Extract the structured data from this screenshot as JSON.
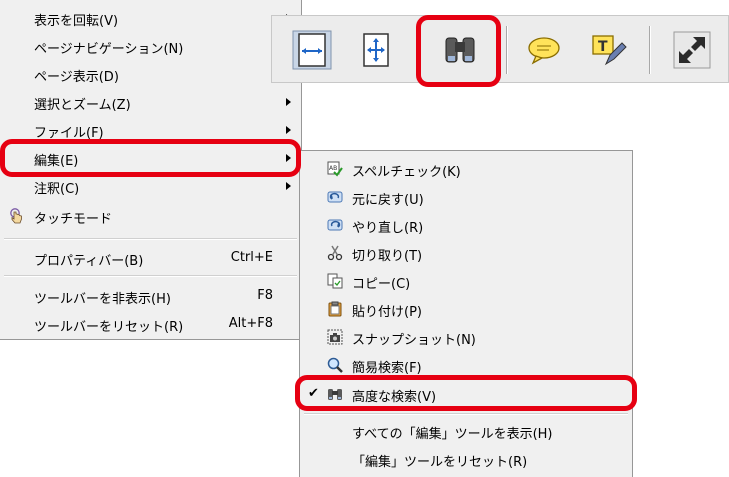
{
  "main_menu": {
    "items": [
      {
        "label": "表示を回転(V)",
        "arrow": true
      },
      {
        "label": "ページナビゲーション(N)"
      },
      {
        "label": "ページ表示(D)"
      },
      {
        "label": "選択とズーム(Z)",
        "arrow": true
      },
      {
        "label": "ファイル(F)",
        "arrow": true
      },
      {
        "label": "編集(E)",
        "arrow": true
      },
      {
        "label": "注釈(C)",
        "arrow": true
      },
      {
        "label": "タッチモード",
        "icon": "touch-hand-icon"
      },
      {
        "label": "プロパティバー(B)",
        "shortcut": "Ctrl+E"
      },
      {
        "label": "ツールバーを非表示(H)",
        "shortcut": "F8"
      },
      {
        "label": "ツールバーをリセット(R)",
        "shortcut": "Alt+F8"
      }
    ]
  },
  "edit_menu": {
    "items": [
      {
        "label": "スペルチェック(K)",
        "icon": "spellcheck-icon"
      },
      {
        "label": "元に戻す(U)",
        "icon": "undo-icon"
      },
      {
        "label": "やり直し(R)",
        "icon": "redo-icon"
      },
      {
        "label": "切り取り(T)",
        "icon": "scissors-icon"
      },
      {
        "label": "コピー(C)",
        "icon": "copy-icon"
      },
      {
        "label": "貼り付け(P)",
        "icon": "paste-icon"
      },
      {
        "label": "スナップショット(N)",
        "icon": "camera-icon"
      },
      {
        "label": "簡易検索(F)",
        "icon": "magnifier-icon"
      },
      {
        "label": "高度な検索(V)",
        "icon": "binoculars-icon",
        "checked": true,
        "check_mark": "✔"
      },
      {
        "label": "すべての「編集」ツールを表示(H)"
      },
      {
        "label": "「編集」ツールをリセット(R)"
      }
    ]
  },
  "toolbar": {
    "buttons": [
      {
        "name": "fit-width-icon"
      },
      {
        "name": "fit-page-icon"
      },
      {
        "name": "binoculars-icon"
      },
      {
        "name": "comment-bubble-icon"
      },
      {
        "name": "text-edit-icon"
      },
      {
        "name": "fullscreen-icon"
      }
    ]
  },
  "colors": {
    "highlight": "#e60012",
    "menu_bg": "#f0f0f0",
    "toolbar_bg": "#ececec"
  }
}
